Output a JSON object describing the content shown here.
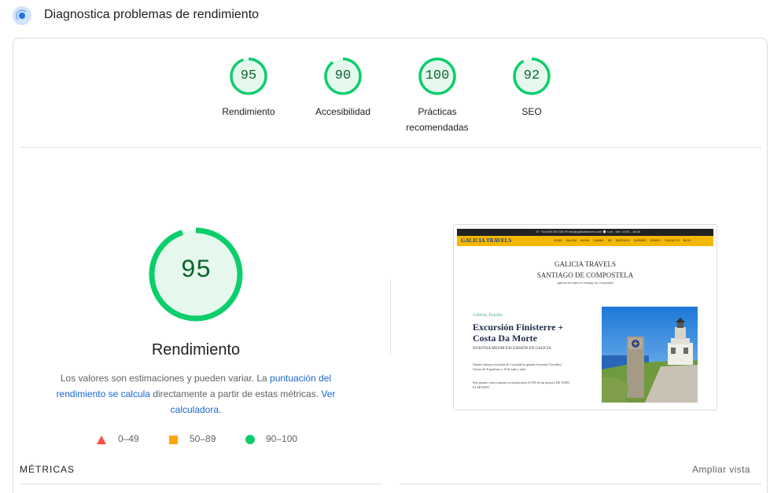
{
  "header": {
    "title": "Diagnostica problemas de rendimiento",
    "icon": "lighthouse-icon"
  },
  "colors": {
    "pass_green": "#0cce6b",
    "pass_text": "#0d652d",
    "pass_fill": "#e6f8ee",
    "average_orange": "#ffa400",
    "fail_red": "#ff4e42",
    "link_blue": "#1967d2"
  },
  "gauges": [
    {
      "score": "95",
      "value": 95,
      "label": "Rendimiento"
    },
    {
      "score": "90",
      "value": 90,
      "label": "Accesibilidad"
    },
    {
      "score": "100",
      "value": 100,
      "label": "Prácticas recomendadas"
    },
    {
      "score": "92",
      "value": 92,
      "label": "SEO"
    }
  ],
  "performance": {
    "score": "95",
    "value": 95,
    "title": "Rendimiento",
    "desc_text_1": "Los valores son estimaciones y pueden variar. La ",
    "desc_link_1": "puntuación del rendimiento se calcula",
    "desc_text_2": " directamente a partir de estas métricas. ",
    "desc_link_2": "Ver calculadora."
  },
  "legend": [
    {
      "range": "0–49",
      "shape": "triangle"
    },
    {
      "range": "50–89",
      "shape": "square"
    },
    {
      "range": "90–100",
      "shape": "circle"
    }
  ],
  "screenshot": {
    "topbar": "☏ +34 636 000 000   ✉ info@galiciatravels.com   ⌚ Lun - Vie: 10:00 - 18:00",
    "logo": "GALICIA TRAVELS",
    "nav": "HOME GALICIA MUXÍA CAMINO DE SANTIAGO QUIENES SOMOS CONTACTO BLOG",
    "heading_line1": "GALICIA TRAVELS",
    "heading_line2": "SANTIAGO DE COMPOSTELA",
    "subheading": "Agencia de viajes en Santiago de Compostela",
    "kicker": "Galicia, España",
    "title": "Excursión Finisterre + Costa Da Morte",
    "tagline": "NUESTRA MEJOR EXCURSIÓN EN GALICIA",
    "p1": "Nuestra famosa excursión de 1 jornada ha ganado el premio Travellers' Choice de Tripadvisor a 10 de [año y año].",
    "p2": "Este premio coloca nuestra excursión entre el 10% de las mejores DE TODO EL MUNDO."
  },
  "metrics": {
    "label": "MÉTRICAS",
    "expand_label": "Ampliar vista"
  }
}
